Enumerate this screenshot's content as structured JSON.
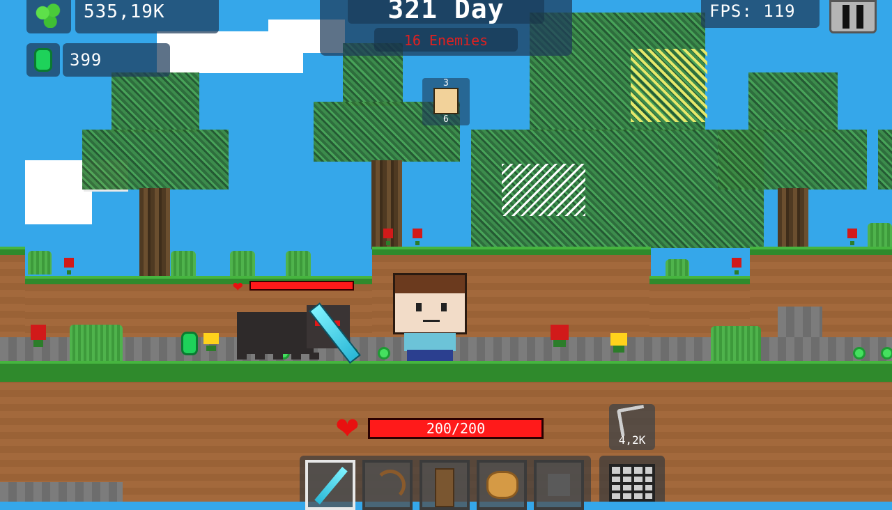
{
  "hud": {
    "currency": {
      "icon": "green-coins-icon",
      "value": "535,19K"
    },
    "emeralds": {
      "icon": "emerald-icon",
      "value": "399"
    },
    "day": {
      "label": "321 Day"
    },
    "enemies": {
      "label": "16 Enemies",
      "color": "#e02020"
    },
    "fps": {
      "label": "FPS: 119"
    },
    "pause": {
      "icon": "pause-icon"
    },
    "companion": {
      "icon": "companion-face-icon",
      "top_digit": "3",
      "bottom_digit": "6"
    }
  },
  "player": {
    "health_label": "200/200",
    "health_fraction": 1.0
  },
  "enemy": {
    "name_icon": "spider-icon",
    "health_fraction": 1.0
  },
  "tool": {
    "icon": "pickaxe-icon",
    "value": "4,2K"
  },
  "hotbar": {
    "slots": [
      {
        "icon": "diamond-sword-icon",
        "selected": true
      },
      {
        "icon": "bow-icon",
        "selected": false
      },
      {
        "icon": "wooden-door-icon",
        "selected": false
      },
      {
        "icon": "potato-icon",
        "selected": false
      },
      {
        "icon": "empty-slot-icon",
        "selected": false
      }
    ],
    "inventory_icon": "inventory-grid-icon"
  },
  "colors": {
    "sky": "#35a7ea",
    "grass": "#2f8a2c",
    "dirt": "#a3693c",
    "health_red": "#ff1a1a"
  }
}
